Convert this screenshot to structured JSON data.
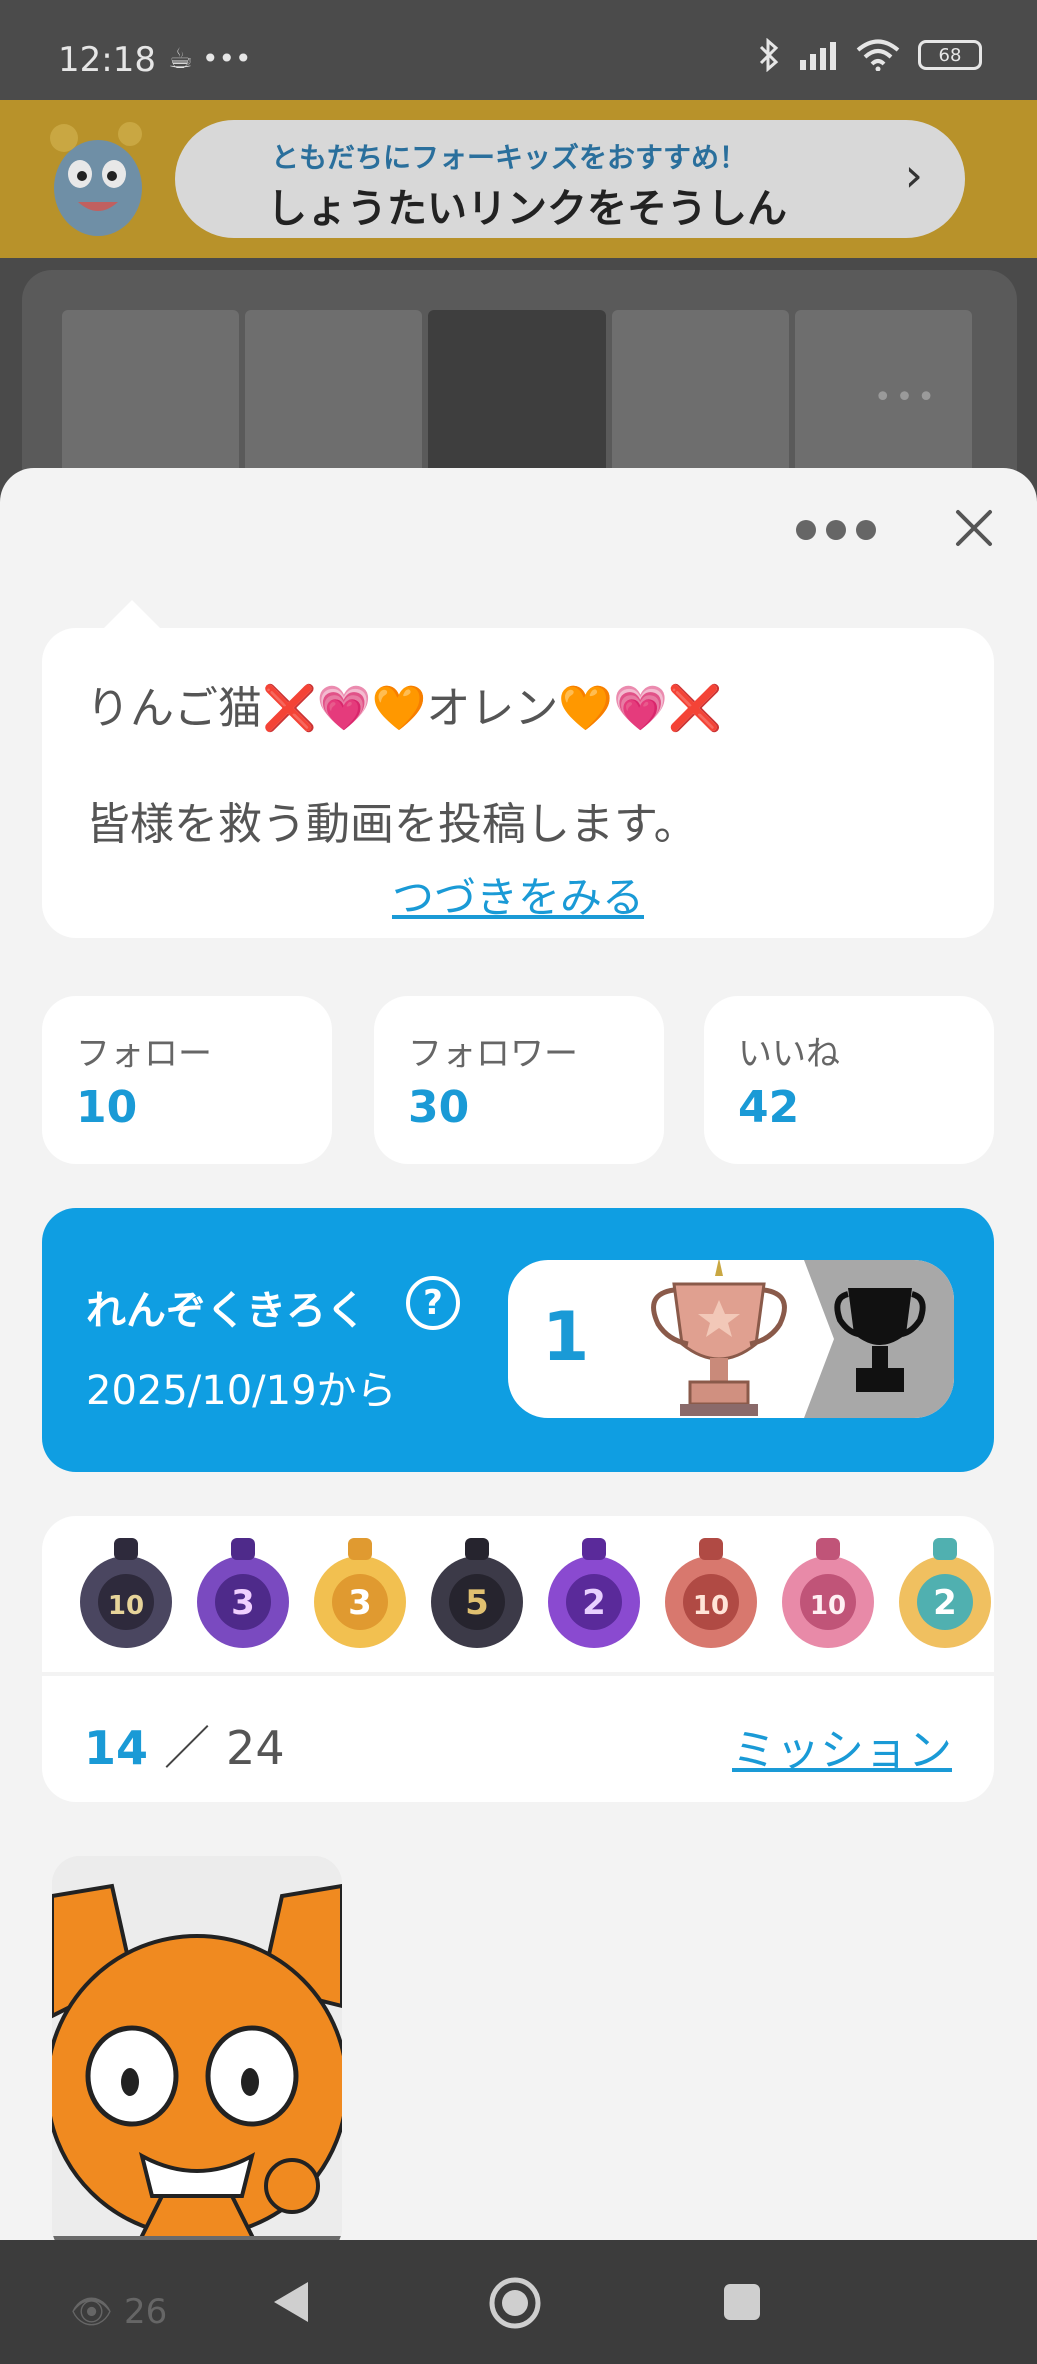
{
  "status_bar": {
    "time": "12:18",
    "extra_icons": "☕ •••",
    "battery": "68"
  },
  "banner": {
    "subtitle": "ともだちにフォーキッズをおすすめ！",
    "title": "しょうたいリンクをそうしん"
  },
  "profile": {
    "name": "りんご猫❌💗🧡オレン🧡💗❌",
    "bio": "皆様を救う動画を投稿します。",
    "more_link": "つづきをみる"
  },
  "stats": [
    {
      "label": "フォロー",
      "value": "10"
    },
    {
      "label": "フォロワー",
      "value": "30"
    },
    {
      "label": "いいね",
      "value": "42"
    }
  ],
  "streak": {
    "title": "れんぞくきろく",
    "help": "?",
    "since": "2025/10/19から",
    "count": "1"
  },
  "badges": {
    "items": [
      "10",
      "3",
      "3",
      "5",
      "2",
      "10",
      "10",
      "2"
    ],
    "earned": "14",
    "separator": "／",
    "total": "24",
    "mission_link": "ミッション"
  },
  "post": {
    "views": "26"
  },
  "colors": {
    "accent": "#1a9ad6",
    "streak_bg": "#0f9ee2",
    "sheet_bg": "#f3f3f3"
  }
}
